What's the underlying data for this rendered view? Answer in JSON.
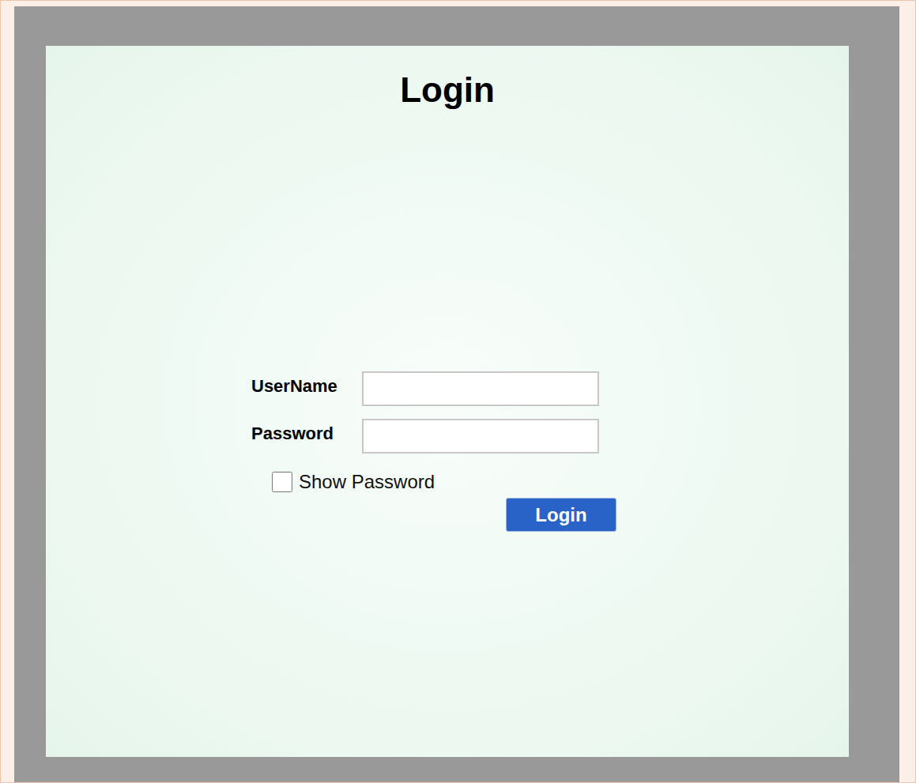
{
  "title": "Login",
  "fields": [
    {
      "label": "UserName",
      "kind": "text",
      "value": ""
    },
    {
      "label": "Password",
      "kind": "password",
      "value": ""
    }
  ],
  "show_password": {
    "label": "Show Password",
    "checked": false
  },
  "login_button": "Login"
}
